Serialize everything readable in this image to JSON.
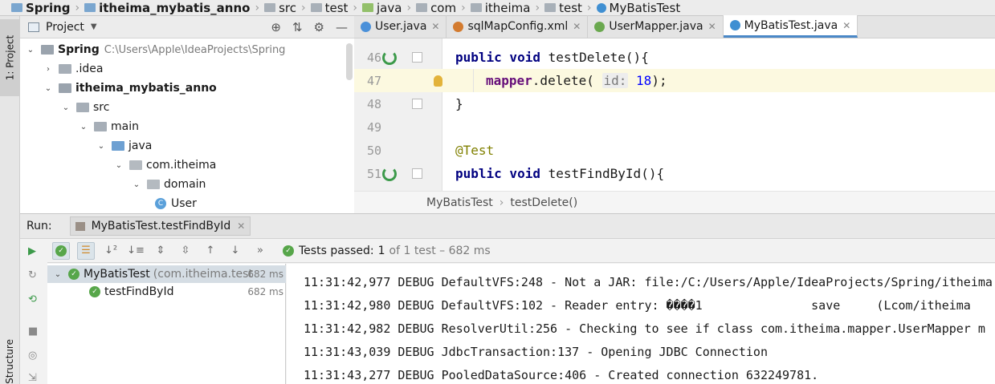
{
  "breadcrumb": [
    "Spring",
    "itheima_mybatis_anno",
    "src",
    "test",
    "java",
    "com",
    "itheima",
    "test",
    "MyBatisTest"
  ],
  "sidebar": {
    "project_tab": "1: Project",
    "structure_tab": "Z: Structure"
  },
  "project_panel": {
    "title": "Project",
    "tree": [
      {
        "label": "Spring",
        "hint": "C:\\Users\\Apple\\IdeaProjects\\Spring",
        "bold": true
      },
      {
        "label": ".idea"
      },
      {
        "label": "itheima_mybatis_anno",
        "bold": true
      },
      {
        "label": "src"
      },
      {
        "label": "main"
      },
      {
        "label": "java"
      },
      {
        "label": "com.itheima"
      },
      {
        "label": "domain"
      },
      {
        "label": "User"
      }
    ]
  },
  "editor": {
    "tabs": [
      {
        "label": "User.java",
        "color": "#4a90d9"
      },
      {
        "label": "sqlMapConfig.xml",
        "color": "#d37b2f"
      },
      {
        "label": "UserMapper.java",
        "color": "#6aa84f"
      },
      {
        "label": "MyBatisTest.java",
        "color": "#3f8fd2",
        "active": true
      }
    ],
    "lines": [
      {
        "num": "46",
        "parts": [
          [
            "kw",
            "public void "
          ],
          [
            "",
            "testDelete(){"
          ]
        ]
      },
      {
        "num": "47",
        "parts": [
          [
            "fld",
            "mapper"
          ],
          [
            "",
            ".delete( "
          ],
          [
            "hint",
            "id:"
          ],
          [
            "",
            " "
          ],
          [
            "num",
            "18"
          ],
          [
            "",
            ");"
          ]
        ]
      },
      {
        "num": "48",
        "parts": [
          [
            "",
            "}"
          ]
        ]
      },
      {
        "num": "49",
        "parts": []
      },
      {
        "num": "50",
        "parts": [
          [
            "anno",
            "@Test"
          ]
        ]
      },
      {
        "num": "51",
        "parts": [
          [
            "kw",
            "public void "
          ],
          [
            "",
            "testFindById(){"
          ]
        ]
      }
    ],
    "breadcrumb_class": "MyBatisTest",
    "breadcrumb_method": "testDelete()"
  },
  "run": {
    "label": "Run:",
    "tab": "MyBatisTest.testFindById",
    "status_passed": "Tests passed:",
    "status_count": "1",
    "status_detail": "of 1 test – 682 ms",
    "tree": [
      {
        "label": "MyBatisTest",
        "pkg": "(com.itheima.test",
        "time": "682 ms"
      },
      {
        "label": "testFindById",
        "time": "682 ms"
      }
    ],
    "console": [
      "11:31:42,977 DEBUG DefaultVFS:248 - Not a JAR: file:/C:/Users/Apple/IdeaProjects/Spring/itheima",
      "11:31:42,980 DEBUG DefaultVFS:102 - Reader entry: ����1               save     (Lcom/itheima",
      "11:31:42,982 DEBUG ResolverUtil:256 - Checking to see if class com.itheima.mapper.UserMapper m",
      "11:31:43,039 DEBUG JdbcTransaction:137 - Opening JDBC Connection",
      "11:31:43,277 DEBUG PooledDataSource:406 - Created connection 632249781."
    ]
  }
}
